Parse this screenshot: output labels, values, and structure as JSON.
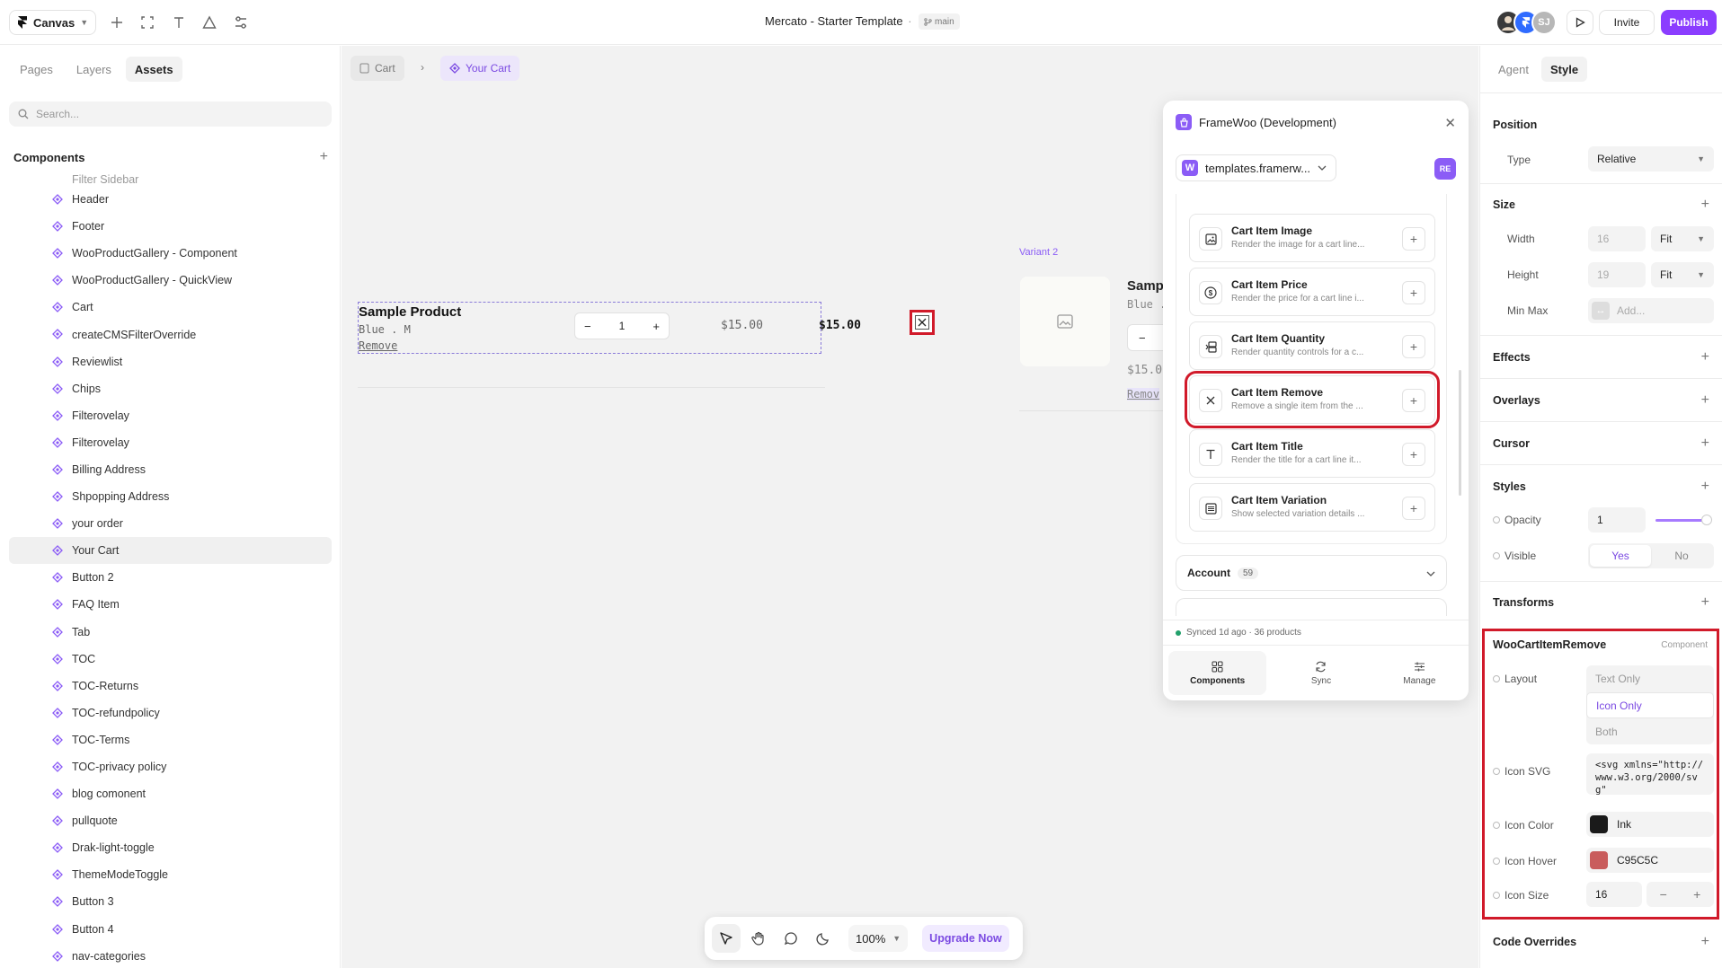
{
  "topbar": {
    "app_name": "Canvas",
    "doc_title": "Mercato - Starter Template",
    "separator": "·",
    "branch": "main",
    "avatar_initials": "SJ",
    "invite_label": "Invite",
    "publish_label": "Publish",
    "accent": "#8b3dff"
  },
  "left_panel": {
    "tabs": [
      "Pages",
      "Layers",
      "Assets"
    ],
    "active_tab": "Assets",
    "search_placeholder": "Search...",
    "section_title": "Components",
    "partial_item": "Filter Sidebar",
    "items": [
      "Header",
      "Footer",
      "WooProductGallery - Component",
      "WooProductGallery - QuickView",
      "Cart",
      "createCMSFilterOverride",
      "Reviewlist",
      "Chips",
      "Filterovelay",
      "Filterovelay",
      "Billing Address",
      "Shpopping Address",
      "your order",
      "Your Cart",
      "Button 2",
      "FAQ Item",
      "Tab",
      "TOC",
      "TOC-Returns",
      "TOC-refundpolicy",
      "TOC-Terms",
      "TOC-privacy policy",
      "blog comonent",
      "pullquote",
      "Drak-light-toggle",
      "ThemeModeToggle",
      "Button 3",
      "Button 4",
      "nav-categories"
    ],
    "selected_item": "Your Cart"
  },
  "canvas": {
    "breadcrumb_parent": "Cart",
    "breadcrumb_current": "Your Cart",
    "product": {
      "title": "Sample Product",
      "variation": "Blue . M",
      "remove": "Remove",
      "quantity": "1",
      "price": "$15.00",
      "total": "$15.00"
    },
    "variant2": {
      "label": "Variant 2",
      "title": "Samp",
      "variation": "Blue . M",
      "price": "$15.0",
      "remove": "Remov"
    }
  },
  "plugin": {
    "title": "FrameWoo (Development)",
    "site": "templates.framerw...",
    "site_logo": "W",
    "user_badge": "RE",
    "items": [
      {
        "name": "Cart Item Image",
        "desc": "Render the image for a cart line...",
        "icon": "image-icon"
      },
      {
        "name": "Cart Item Price",
        "desc": "Render the price for a cart line i...",
        "icon": "dollar-icon"
      },
      {
        "name": "Cart Item Quantity",
        "desc": "Render quantity controls for a c...",
        "icon": "quantity-icon"
      },
      {
        "name": "Cart Item Remove",
        "desc": "Remove a single item from the ...",
        "icon": "x-icon"
      },
      {
        "name": "Cart Item Title",
        "desc": "Render the title for a cart line it...",
        "icon": "text-icon"
      },
      {
        "name": "Cart Item Variation",
        "desc": "Show selected variation details ...",
        "icon": "list-icon"
      }
    ],
    "accordion": {
      "title": "Account",
      "count": "59"
    },
    "sync_status": "Synced 1d ago · 36 products",
    "nav": [
      "Components",
      "Sync",
      "Manage"
    ]
  },
  "bottom_toolbar": {
    "zoom": "100%",
    "upgrade_label": "Upgrade Now"
  },
  "right_panel": {
    "tabs": [
      "Agent",
      "Style"
    ],
    "active_tab": "Style",
    "position": {
      "title": "Position",
      "type_label": "Type",
      "type_value": "Relative"
    },
    "size": {
      "title": "Size",
      "width_label": "Width",
      "width_value": "16",
      "width_mode": "Fit",
      "height_label": "Height",
      "height_value": "19",
      "height_mode": "Fit",
      "minmax_label": "Min Max",
      "minmax_placeholder": "Add..."
    },
    "sections": [
      "Effects",
      "Overlays",
      "Cursor"
    ],
    "styles": {
      "title": "Styles",
      "opacity_label": "Opacity",
      "opacity_value": "1",
      "visible_label": "Visible",
      "visible_yes": "Yes",
      "visible_no": "No"
    },
    "transforms_title": "Transforms",
    "component": {
      "name": "WooCartItemRemove",
      "kind": "Component",
      "layout_label": "Layout",
      "layout_options": [
        "Text Only",
        "Icon Only",
        "Both"
      ],
      "layout_selected": "Icon Only",
      "icon_svg_label": "Icon SVG",
      "icon_svg_value": "<svg xmlns=\"http://www.w3.org/2000/svg\"",
      "icon_color_label": "Icon Color",
      "icon_color_value": "Ink",
      "icon_color_hex": "#1a1a1a",
      "icon_hover_label": "Icon Hover",
      "icon_hover_value": "C95C5C",
      "icon_hover_hex": "#C95C5C",
      "icon_size_label": "Icon Size",
      "icon_size_value": "16"
    },
    "code_overrides_title": "Code Overrides"
  }
}
